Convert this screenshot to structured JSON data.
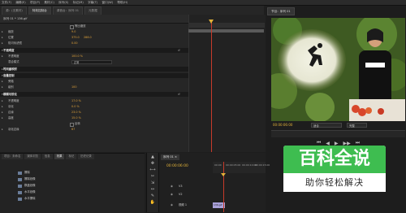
{
  "menubar": [
    "文件(F)",
    "编辑(E)",
    "项目(P)",
    "素材(C)",
    "序列(S)",
    "标记(M)",
    "字幕(T)",
    "窗口(W)",
    "帮助(H)"
  ],
  "top_tabs": [
    {
      "label": "源：(无素材)",
      "active": false
    },
    {
      "label": "特效控制台",
      "active": true
    },
    {
      "label": "调音台：序列 01",
      "active": false
    },
    {
      "label": "元数据",
      "active": false
    }
  ],
  "effect_controls": {
    "clip_title": "序列 01 * 136.gif",
    "timecode": "00:00",
    "properties": [
      {
        "kind": "check",
        "label": "等比缩放"
      },
      {
        "kind": "prop",
        "label": "缩放",
        "value": "9.0"
      },
      {
        "kind": "prop",
        "label": "位置",
        "value": "375.0",
        "value2": "288.0"
      },
      {
        "kind": "prop",
        "label": "防闪烁滤镜",
        "value": "0.00"
      },
      {
        "kind": "section",
        "label": "不透明度"
      },
      {
        "kind": "prop",
        "label": "不透明度",
        "value": "100.0 %"
      },
      {
        "kind": "select",
        "label": "混合模式",
        "value": "正常"
      },
      {
        "kind": "section",
        "label": "时间重映射"
      },
      {
        "kind": "section",
        "label": "音量控制"
      },
      {
        "kind": "prop",
        "label": "旁路",
        "value": ""
      },
      {
        "kind": "prop",
        "label": "级别",
        "value": "100"
      },
      {
        "kind": "section",
        "label": "模糊与锐化"
      },
      {
        "kind": "prop",
        "label": "不透明度",
        "value": "17.0 %"
      },
      {
        "kind": "prop",
        "label": "羽化",
        "value": "0.0 %"
      },
      {
        "kind": "prop",
        "label": "边缘",
        "value": "23.0 %"
      },
      {
        "kind": "prop",
        "label": "高度",
        "value": "15.0 %"
      },
      {
        "kind": "check",
        "label": "反转"
      },
      {
        "kind": "prop",
        "label": "羽化边缘",
        "value": "67"
      }
    ]
  },
  "program": {
    "title": "节目：序列 01",
    "timecode": "00:00:06:00",
    "fit_label": "适合",
    "scale_label": "完整",
    "controls": [
      "⏮",
      "◀",
      "▶",
      "▶▶",
      "⏭"
    ]
  },
  "bottom_left": {
    "tabs": [
      {
        "label": "项目：未命名",
        "active": false
      },
      {
        "label": "媒体浏览",
        "active": false
      },
      {
        "label": "信息",
        "active": false
      },
      {
        "label": "效果",
        "active": true
      },
      {
        "label": "标记",
        "active": false
      },
      {
        "label": "历史记录",
        "active": false
      }
    ],
    "tree": [
      "擦除",
      "擦除划像",
      "棋盘划像",
      "水平划像",
      "水平擦除"
    ]
  },
  "tools": [
    "▲",
    "✥",
    "⟷",
    "✂",
    "⇲",
    "↔",
    "✎",
    "✋"
  ],
  "sequence": {
    "tab": "序列 01 ×",
    "timecode": "00:00:06:00",
    "ruler": [
      "00:00",
      "00:00:05:00",
      "00:00:10:00",
      "00:00:15:00"
    ],
    "tracks": [
      {
        "name": "V3"
      },
      {
        "name": "V2"
      },
      {
        "name": "视频 1"
      }
    ],
    "clip_label": "136.gif"
  },
  "watermark": {
    "title": "百科全说",
    "subtitle": "助你轻松解决"
  },
  "colors": {
    "accent_timecode": "#e2b33a",
    "playhead": "#c73a2a",
    "watermark_green": "#3ebd50"
  }
}
